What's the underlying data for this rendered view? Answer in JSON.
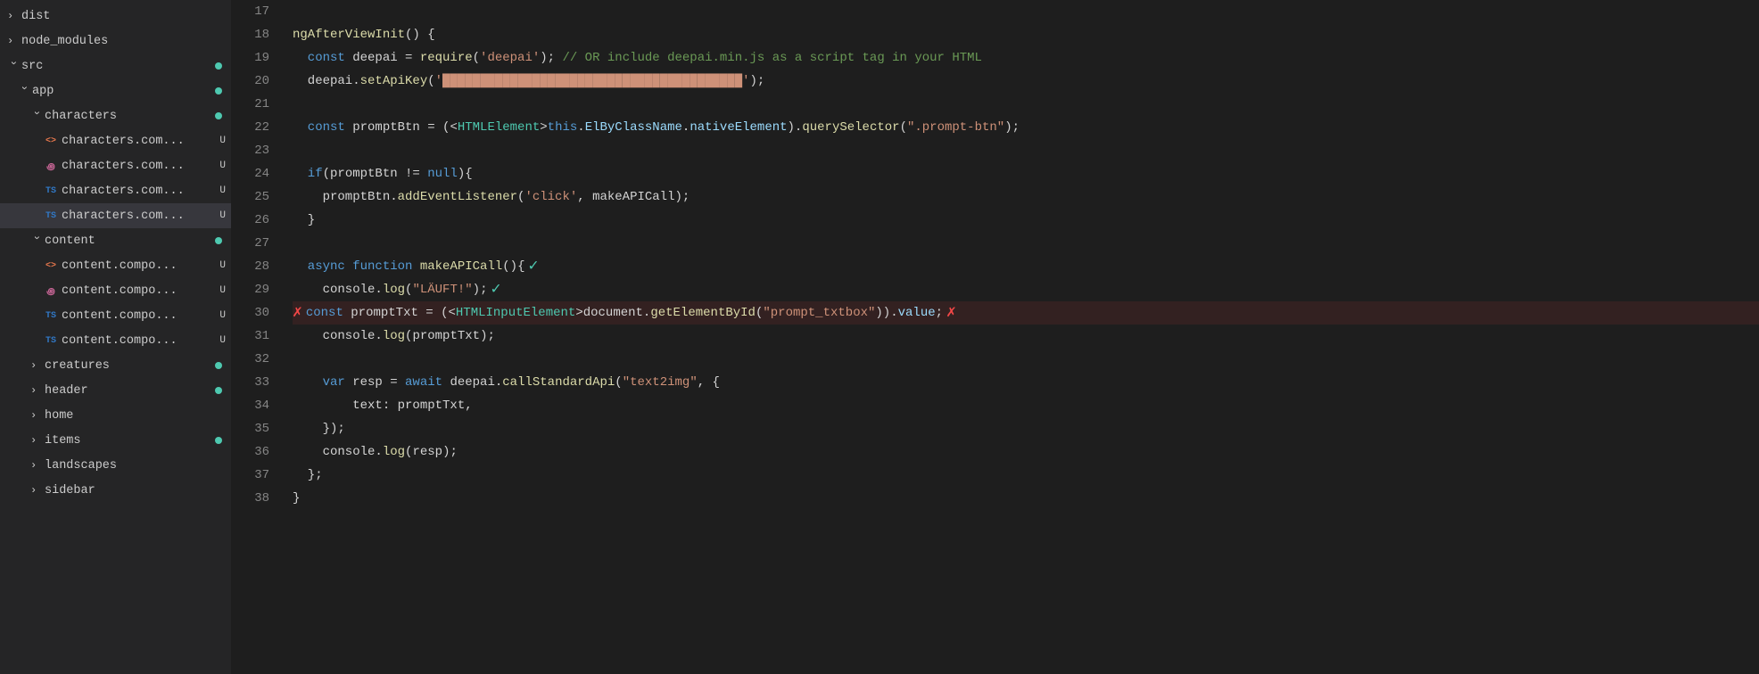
{
  "sidebar": {
    "items": [
      {
        "id": "dist",
        "label": "dist",
        "type": "folder-collapsed",
        "indent": 0,
        "dot": null
      },
      {
        "id": "node_modules",
        "label": "node_modules",
        "type": "folder-collapsed",
        "indent": 0,
        "dot": null
      },
      {
        "id": "src",
        "label": "src",
        "type": "folder-open",
        "indent": 0,
        "dot": "green"
      },
      {
        "id": "app",
        "label": "app",
        "type": "folder-open",
        "indent": 1,
        "dot": "green"
      },
      {
        "id": "characters",
        "label": "characters",
        "type": "folder-open",
        "indent": 2,
        "dot": "green"
      },
      {
        "id": "char1",
        "label": "characters.com...",
        "type": "file-html",
        "indent": 3,
        "dot": null,
        "badge": "U"
      },
      {
        "id": "char2",
        "label": "characters.com...",
        "type": "file-scss",
        "indent": 3,
        "dot": null,
        "badge": "U"
      },
      {
        "id": "char3",
        "label": "characters.com...",
        "type": "file-ts",
        "indent": 3,
        "dot": null,
        "badge": "U"
      },
      {
        "id": "char4",
        "label": "characters.com...",
        "type": "file-ts-active",
        "indent": 3,
        "dot": null,
        "badge": "U",
        "active": true
      },
      {
        "id": "content",
        "label": "content",
        "type": "folder-open",
        "indent": 2,
        "dot": "green"
      },
      {
        "id": "cont1",
        "label": "content.compo...",
        "type": "file-html",
        "indent": 3,
        "dot": null,
        "badge": "U"
      },
      {
        "id": "cont2",
        "label": "content.compo...",
        "type": "file-scss",
        "indent": 3,
        "dot": null,
        "badge": "U"
      },
      {
        "id": "cont3",
        "label": "content.compo...",
        "type": "file-ts",
        "indent": 3,
        "dot": null,
        "badge": "U"
      },
      {
        "id": "cont4",
        "label": "content.compo...",
        "type": "file-ts",
        "indent": 3,
        "dot": null,
        "badge": "U"
      },
      {
        "id": "creatures",
        "label": "creatures",
        "type": "folder-collapsed",
        "indent": 2,
        "dot": "green"
      },
      {
        "id": "header",
        "label": "header",
        "type": "folder-collapsed",
        "indent": 2,
        "dot": "green"
      },
      {
        "id": "home",
        "label": "home",
        "type": "folder-collapsed",
        "indent": 2,
        "dot": null
      },
      {
        "id": "items",
        "label": "items",
        "type": "folder-collapsed",
        "indent": 2,
        "dot": "green"
      },
      {
        "id": "landscapes",
        "label": "landscapes",
        "type": "folder-collapsed",
        "indent": 2,
        "dot": null
      },
      {
        "id": "sidebar-folder",
        "label": "sidebar",
        "type": "folder-collapsed",
        "indent": 2,
        "dot": null
      }
    ]
  },
  "lines": [
    {
      "num": 17,
      "tokens": []
    },
    {
      "num": 18,
      "tokens": [
        {
          "t": "fn",
          "v": "ngAfterViewInit"
        },
        {
          "t": "pn",
          "v": "() {"
        }
      ]
    },
    {
      "num": 19,
      "tokens": [
        {
          "t": "kw",
          "v": "  const"
        },
        {
          "t": "plain",
          "v": " deepai = "
        },
        {
          "t": "fn",
          "v": "require"
        },
        {
          "t": "pn",
          "v": "("
        },
        {
          "t": "str",
          "v": "'deepai'"
        },
        {
          "t": "pn",
          "v": ");"
        },
        {
          "t": "cm",
          "v": " // OR include deepai.min.js as a script tag in your HTML"
        }
      ]
    },
    {
      "num": 20,
      "tokens": [
        {
          "t": "plain",
          "v": "  deepai."
        },
        {
          "t": "fn",
          "v": "setApiKey"
        },
        {
          "t": "pn",
          "v": "("
        },
        {
          "t": "str",
          "v": "'████████████████████████████████████████'"
        },
        {
          "t": "pn",
          "v": ");"
        }
      ]
    },
    {
      "num": 21,
      "tokens": []
    },
    {
      "num": 22,
      "tokens": [
        {
          "t": "kw",
          "v": "  const"
        },
        {
          "t": "plain",
          "v": " promptBtn = ("
        },
        {
          "t": "pn",
          "v": "<"
        },
        {
          "t": "cl",
          "v": "HTMLElement"
        },
        {
          "t": "pn",
          "v": ">"
        },
        {
          "t": "kw",
          "v": "this"
        },
        {
          "t": "pn",
          "v": "."
        },
        {
          "t": "prop",
          "v": "ElByClassName"
        },
        {
          "t": "pn",
          "v": "."
        },
        {
          "t": "prop",
          "v": "nativeElement"
        },
        {
          "t": "pn",
          "v": ")."
        },
        {
          "t": "fn",
          "v": "querySelector"
        },
        {
          "t": "pn",
          "v": "("
        },
        {
          "t": "str",
          "v": "\".prompt-btn\""
        },
        {
          "t": "pn",
          "v": ");"
        }
      ]
    },
    {
      "num": 23,
      "tokens": []
    },
    {
      "num": 24,
      "tokens": [
        {
          "t": "kw",
          "v": "  if"
        },
        {
          "t": "pn",
          "v": "(promptBtn != "
        },
        {
          "t": "kw",
          "v": "null"
        },
        {
          "t": "pn",
          "v": "){"
        }
      ]
    },
    {
      "num": 25,
      "tokens": [
        {
          "t": "plain",
          "v": "    promptBtn."
        },
        {
          "t": "fn",
          "v": "addEventListener"
        },
        {
          "t": "pn",
          "v": "("
        },
        {
          "t": "str",
          "v": "'click'"
        },
        {
          "t": "pn",
          "v": ", makeAPICall);"
        }
      ]
    },
    {
      "num": 26,
      "tokens": [
        {
          "t": "pn",
          "v": "  }"
        }
      ]
    },
    {
      "num": 27,
      "tokens": []
    },
    {
      "num": 28,
      "tokens": [
        {
          "t": "kw",
          "v": "  async"
        },
        {
          "t": "kw",
          "v": " function"
        },
        {
          "t": "fn",
          "v": " makeAPICall"
        },
        {
          "t": "pn",
          "v": "(){"
        },
        {
          "t": "mark",
          "v": "✓",
          "color": "green"
        }
      ]
    },
    {
      "num": 29,
      "tokens": [
        {
          "t": "plain",
          "v": "    console."
        },
        {
          "t": "fn",
          "v": "log"
        },
        {
          "t": "pn",
          "v": "("
        },
        {
          "t": "str",
          "v": "\"LÄUFT!\""
        },
        {
          "t": "pn",
          "v": ");"
        },
        {
          "t": "mark",
          "v": "✓",
          "color": "green"
        }
      ]
    },
    {
      "num": 30,
      "tokens": [
        {
          "t": "mark-left",
          "v": "✗",
          "color": "red"
        },
        {
          "t": "kw",
          "v": "const"
        },
        {
          "t": "plain",
          "v": " promptTxt = ("
        },
        {
          "t": "pn",
          "v": "<"
        },
        {
          "t": "cl",
          "v": "HTMLInputElement"
        },
        {
          "t": "pn",
          "v": ">"
        },
        {
          "t": "plain",
          "v": "document."
        },
        {
          "t": "fn",
          "v": "getElementById"
        },
        {
          "t": "pn",
          "v": "("
        },
        {
          "t": "str",
          "v": "\"prompt_txtbox\""
        },
        {
          "t": "pn",
          "v": "))."
        },
        {
          "t": "prop",
          "v": "value"
        },
        {
          "t": "pn",
          "v": ";"
        },
        {
          "t": "mark",
          "v": "✗",
          "color": "red"
        }
      ],
      "error": true
    },
    {
      "num": 31,
      "tokens": [
        {
          "t": "plain",
          "v": "    console."
        },
        {
          "t": "fn",
          "v": "log"
        },
        {
          "t": "pn",
          "v": "("
        },
        {
          "t": "plain",
          "v": "promptTxt"
        },
        {
          "t": "pn",
          "v": ");"
        }
      ]
    },
    {
      "num": 32,
      "tokens": []
    },
    {
      "num": 33,
      "tokens": [
        {
          "t": "kw",
          "v": "    var"
        },
        {
          "t": "plain",
          "v": " resp = "
        },
        {
          "t": "kw",
          "v": "await"
        },
        {
          "t": "plain",
          "v": " deepai."
        },
        {
          "t": "fn",
          "v": "callStandardApi"
        },
        {
          "t": "pn",
          "v": "("
        },
        {
          "t": "str",
          "v": "\"text2img\""
        },
        {
          "t": "pn",
          "v": ", {"
        }
      ]
    },
    {
      "num": 34,
      "tokens": [
        {
          "t": "plain",
          "v": "        text: promptTxt,"
        }
      ]
    },
    {
      "num": 35,
      "tokens": [
        {
          "t": "pn",
          "v": "    });"
        }
      ]
    },
    {
      "num": 36,
      "tokens": [
        {
          "t": "plain",
          "v": "    console."
        },
        {
          "t": "fn",
          "v": "log"
        },
        {
          "t": "pn",
          "v": "("
        },
        {
          "t": "plain",
          "v": "resp"
        },
        {
          "t": "pn",
          "v": ");"
        }
      ]
    },
    {
      "num": 37,
      "tokens": [
        {
          "t": "pn",
          "v": "  };"
        }
      ]
    },
    {
      "num": 38,
      "tokens": [
        {
          "t": "pn",
          "v": "}"
        }
      ]
    }
  ]
}
